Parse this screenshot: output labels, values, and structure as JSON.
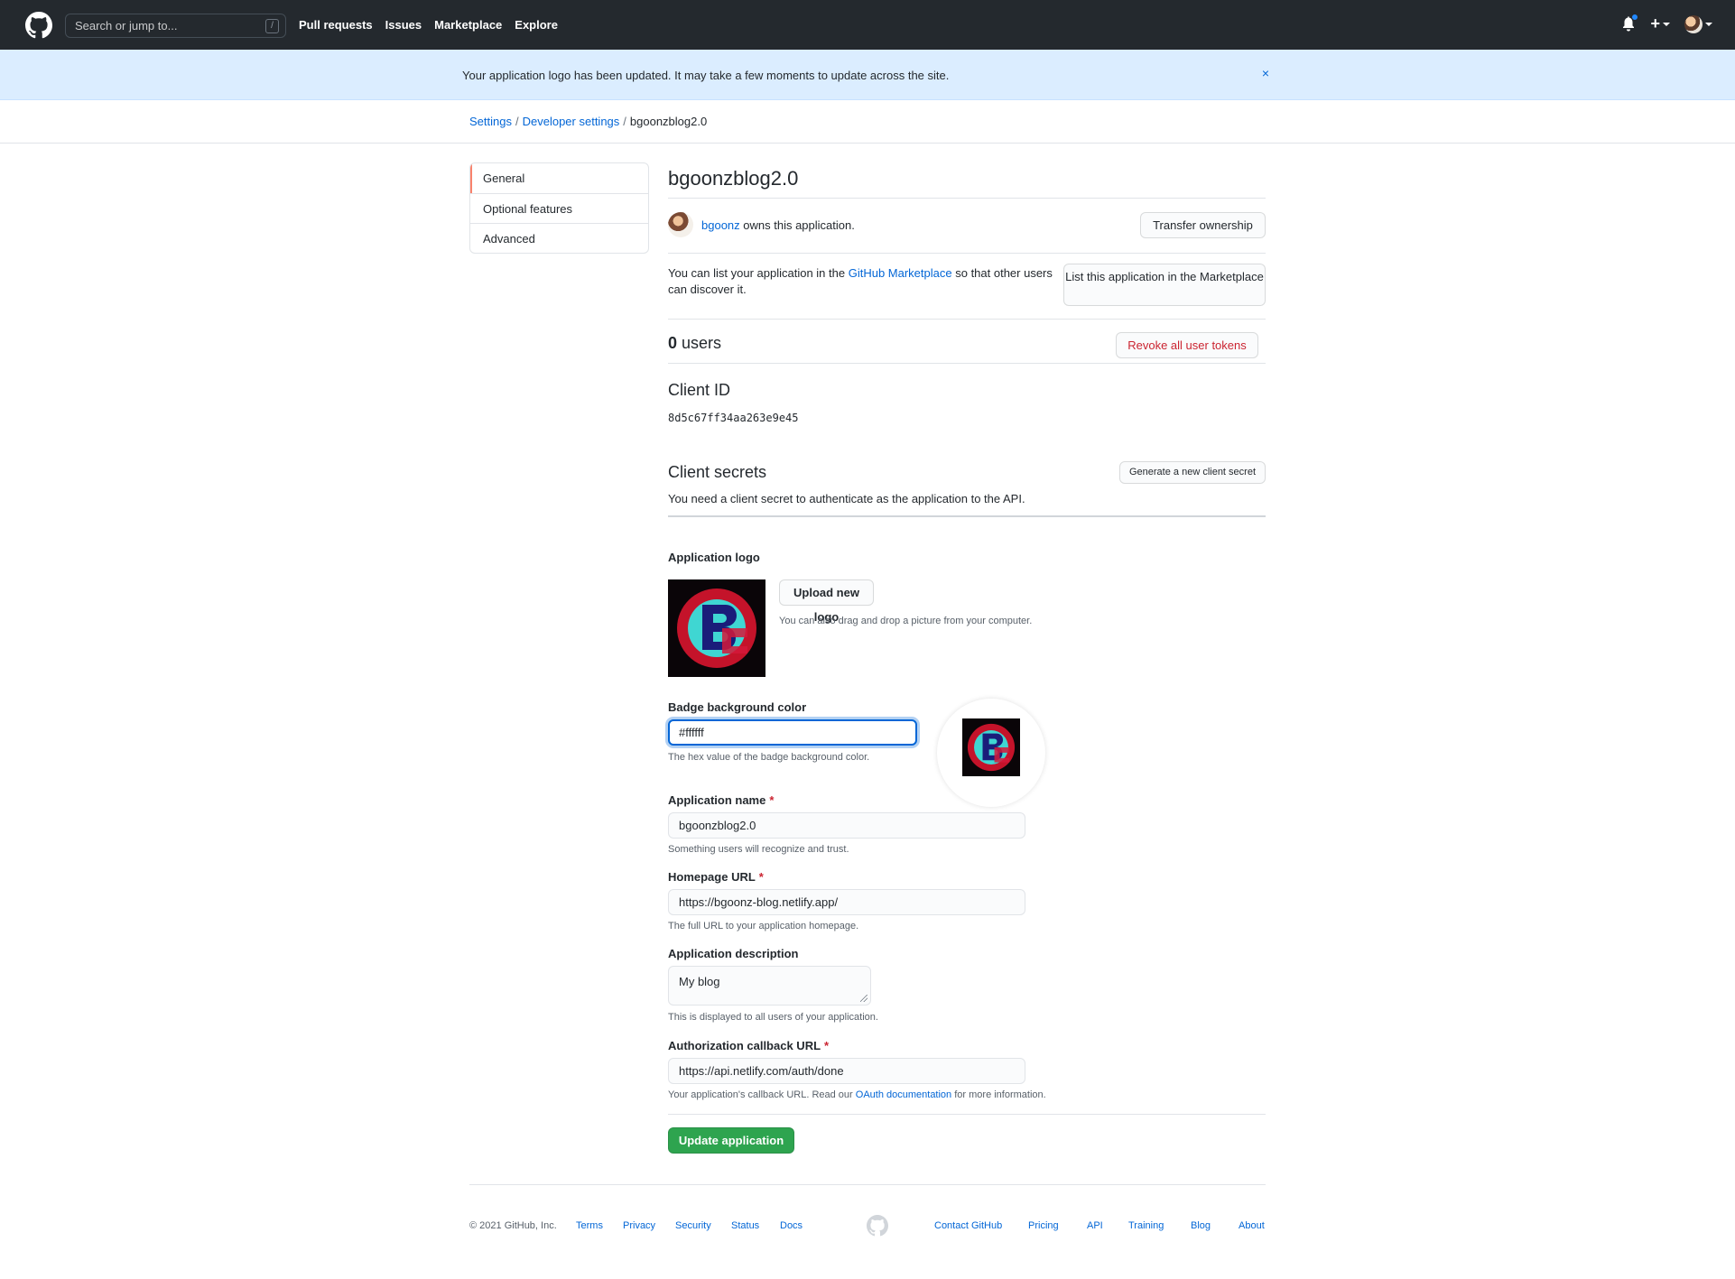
{
  "header": {
    "search_placeholder": "Search or jump to...",
    "search_hotkey": "/",
    "nav": [
      "Pull requests",
      "Issues",
      "Marketplace",
      "Explore"
    ],
    "plus_label": "+"
  },
  "flash": {
    "message": "Your application logo has been updated. It may take a few moments to update across the site.",
    "close": "×"
  },
  "breadcrumb": {
    "settings": "Settings",
    "developer_settings": "Developer settings",
    "current": "bgoonzblog2.0",
    "separator": "/"
  },
  "sidebar": {
    "items": [
      {
        "label": "General"
      },
      {
        "label": "Optional features"
      },
      {
        "label": "Advanced"
      }
    ]
  },
  "app": {
    "title": "bgoonzblog2.0",
    "owner": {
      "name": "bgoonz",
      "suffix": " owns this application.",
      "transfer_button": "Transfer ownership"
    },
    "marketplace": {
      "text_before": "You can list your application in the ",
      "link": "GitHub Marketplace",
      "text_after": " so that other users can discover it.",
      "button": "List this application in the Marketplace"
    },
    "users": {
      "count": "0",
      "label": " users",
      "revoke_button": "Revoke all user tokens"
    },
    "client_id": {
      "heading": "Client ID",
      "value": "8d5c67ff34aa263e9e45"
    },
    "client_secrets": {
      "heading": "Client secrets",
      "button": "Generate a new client secret",
      "note": "You need a client secret to authenticate as the application to the API."
    }
  },
  "form": {
    "logo": {
      "label": "Application logo",
      "upload_button": "Upload new logo",
      "hint": "You can also drag and drop a picture from your computer."
    },
    "badge_color": {
      "label": "Badge background color",
      "value": "#ffffff",
      "hint": "The hex value of the badge background color."
    },
    "app_name": {
      "label": "Application name",
      "required": "*",
      "value": "bgoonzblog2.0",
      "hint": "Something users will recognize and trust."
    },
    "homepage": {
      "label": "Homepage URL",
      "required": "*",
      "value": "https://bgoonz-blog.netlify.app/",
      "hint": "The full URL to your application homepage."
    },
    "description": {
      "label": "Application description",
      "value": "My blog",
      "hint": "This is displayed to all users of your application."
    },
    "callback": {
      "label": "Authorization callback URL",
      "required": "*",
      "value": "https://api.netlify.com/auth/done",
      "hint_before": "Your application's callback URL. Read our ",
      "hint_link": "OAuth documentation",
      "hint_after": " for more information."
    },
    "submit": "Update application"
  },
  "footer": {
    "copyright": "© 2021 GitHub, Inc.",
    "links_left": [
      "Terms",
      "Privacy",
      "Security",
      "Status",
      "Docs"
    ],
    "links_right": [
      "Contact GitHub",
      "Pricing",
      "API",
      "Training",
      "Blog",
      "About"
    ]
  },
  "colors": {
    "header_bg": "#24292e",
    "flash_bg": "#dbedff",
    "link": "#0366d6",
    "primary_button": "#2ea44f",
    "danger": "#cb2431",
    "selected_indicator": "#f9826c"
  }
}
